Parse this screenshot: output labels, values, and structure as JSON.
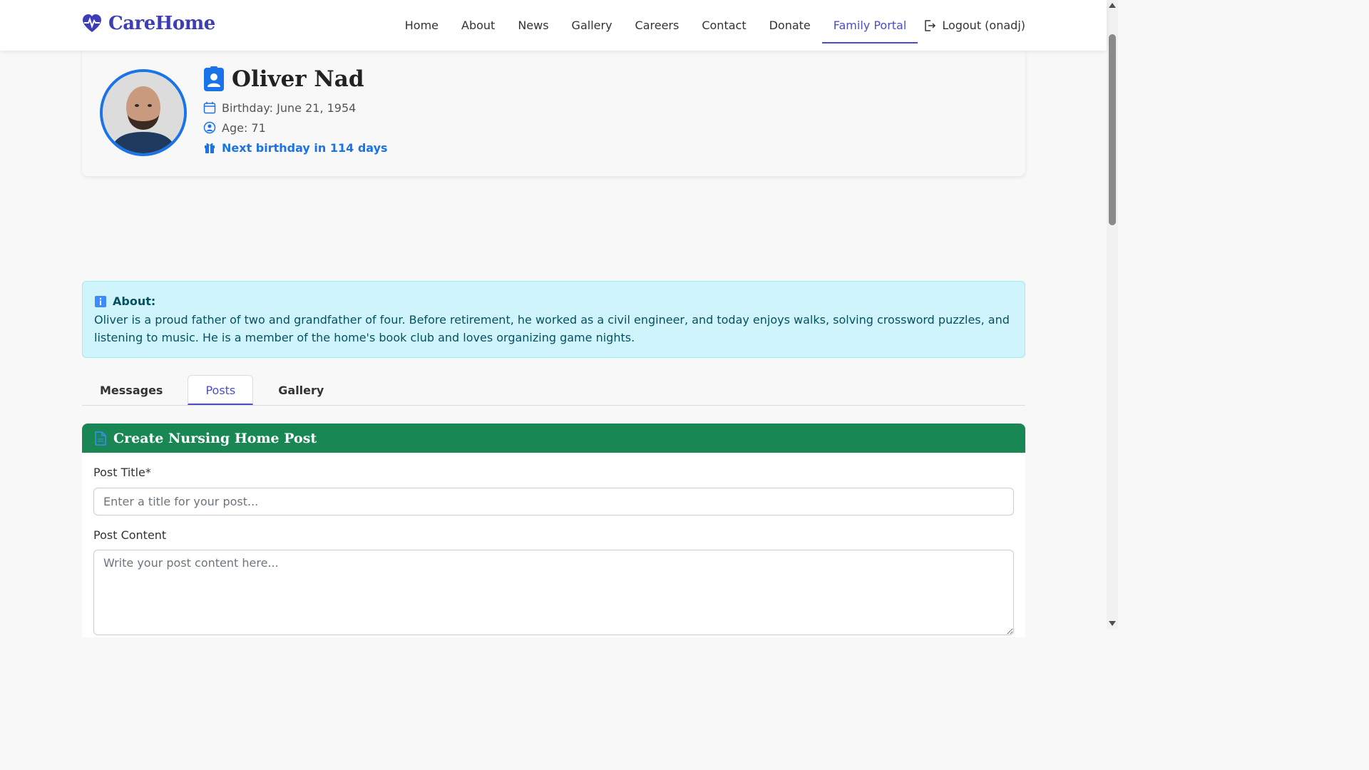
{
  "brand": {
    "name": "CareHome"
  },
  "nav": {
    "links": [
      "Home",
      "About",
      "News",
      "Gallery",
      "Careers",
      "Contact",
      "Donate",
      "Family Portal"
    ],
    "active": "Family Portal",
    "logout_label": "Logout (onadj)"
  },
  "profile": {
    "name": "Oliver Nad",
    "birthday": "Birthday: June 21, 1954",
    "age": "Age: 71",
    "next_birthday": "Next birthday in 114 days"
  },
  "about": {
    "title": "About:",
    "text": "Oliver is a proud father of two and grandfather of four. Before retirement, he worked as a civil engineer, and today enjoys walks, solving crossword puzzles, and listening to music. He is a member of the home's book club and loves organizing game nights."
  },
  "tabs": {
    "items": [
      "Messages",
      "Posts",
      "Gallery"
    ],
    "active": "Posts"
  },
  "post_form": {
    "header": "Create Nursing Home Post",
    "title_label": "Post Title*",
    "title_placeholder": "Enter a title for your post...",
    "content_label": "Post Content",
    "content_placeholder": "Write your post content here..."
  },
  "colors": {
    "brand": "#3d3db8",
    "accent_blue": "#1a73e8",
    "about_bg": "#cff4fc",
    "post_header_bg": "#198754"
  }
}
